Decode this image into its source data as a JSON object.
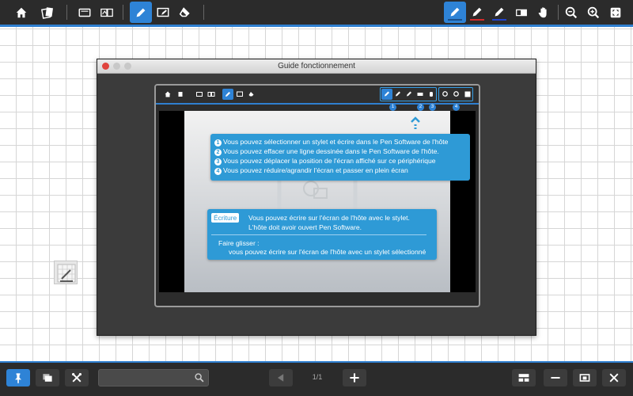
{
  "toolbar": {
    "tools": [
      {
        "name": "home-icon"
      },
      {
        "name": "documents-icon"
      },
      {
        "name": "screen-icon"
      },
      {
        "name": "screen-switch-icon"
      },
      {
        "name": "pen-icon",
        "active": true
      },
      {
        "name": "screen-pen-icon"
      },
      {
        "name": "eraser-icon"
      }
    ],
    "pens": [
      {
        "name": "pen-blue-icon",
        "underline": "#2e83d6",
        "active": true
      },
      {
        "name": "pen-red-icon",
        "underline": "#d32b2b"
      },
      {
        "name": "pen-navy-icon",
        "underline": "#2244cc"
      }
    ],
    "right_tools": [
      "eraser-block-icon",
      "hand-icon",
      "zoom-out-icon",
      "zoom-in-icon",
      "fullscreen-icon"
    ]
  },
  "window": {
    "title": "Guide fonctionnement",
    "buttons": [
      "#e0443e",
      "#c8c8c8",
      "#c8c8c8"
    ]
  },
  "guide": {
    "badges": [
      "1",
      "2",
      "3",
      "4"
    ],
    "items": [
      {
        "num": "1",
        "text": "Vous pouvez sélectionner un stylet et écrire dans le Pen Software de l'hôte"
      },
      {
        "num": "2",
        "text": "Vous pouvez effacer une ligne dessinée dans le Pen Software de l'hôte."
      },
      {
        "num": "3",
        "text": "Vous pouvez déplacer la position de l'écran affiché sur ce périphérique"
      },
      {
        "num": "4",
        "text": "Vous pouvez réduire/agrandir l'écran et passer en plein écran"
      }
    ],
    "writing": {
      "tag": "Écriture",
      "line1": "Vous pouvez écrire sur l'écran de l'hôte avec le stylet.",
      "line2": "L'hôte doit avoir ouvert Pen Software.",
      "line3": "Faire glisser :",
      "line4": "vous pouvez écrire sur l'écran de l'hôte avec un stylet sélectionné"
    }
  },
  "bottom": {
    "pin_active": true,
    "search_value": "",
    "page_indicator": "1/1",
    "colors": {
      "accent": "#2e83d6",
      "bar": "#2b2b2b"
    }
  }
}
